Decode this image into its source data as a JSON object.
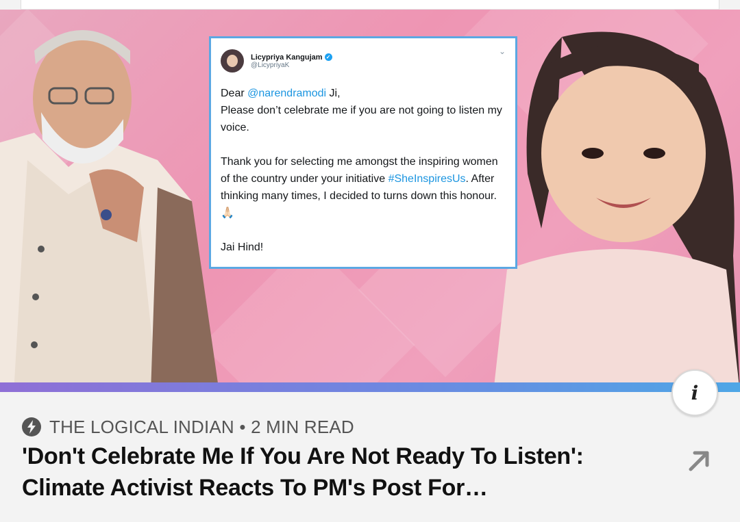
{
  "tweet": {
    "name": "Licypriya Kangujam",
    "handle": "@LicypriyaK",
    "greeting_prefix": "Dear ",
    "mention": "@narendramodi",
    "greeting_suffix": " Ji,",
    "line1": "Please don’t celebrate me if you are not going to listen my voice.",
    "para2_prefix": "Thank you for selecting me amongst the inspiring women of the country under your initiative ",
    "hashtag": "#SheInspiresUs",
    "para2_suffix": ". After thinking many times, I decided to turns down this honour. 🙏🏻",
    "signoff": "Jai Hind!"
  },
  "article": {
    "source": "THE LOGICAL INDIAN",
    "separator": " • ",
    "read_time": "2 MIN READ",
    "headline": "'Don't Celebrate Me If You Are Not Ready To Listen': Climate Activist Reacts To PM's Post For…"
  },
  "info_button": {
    "label": "i"
  },
  "icons": {
    "source": "bolt-icon",
    "open": "arrow-up-right-icon",
    "info": "info-icon"
  },
  "colors": {
    "hero_pink": "#ee95b3",
    "tweet_border": "#5ba8e3",
    "link": "#1b95e0",
    "progress_start": "#8f6fd6",
    "progress_end": "#4ea6e6"
  }
}
